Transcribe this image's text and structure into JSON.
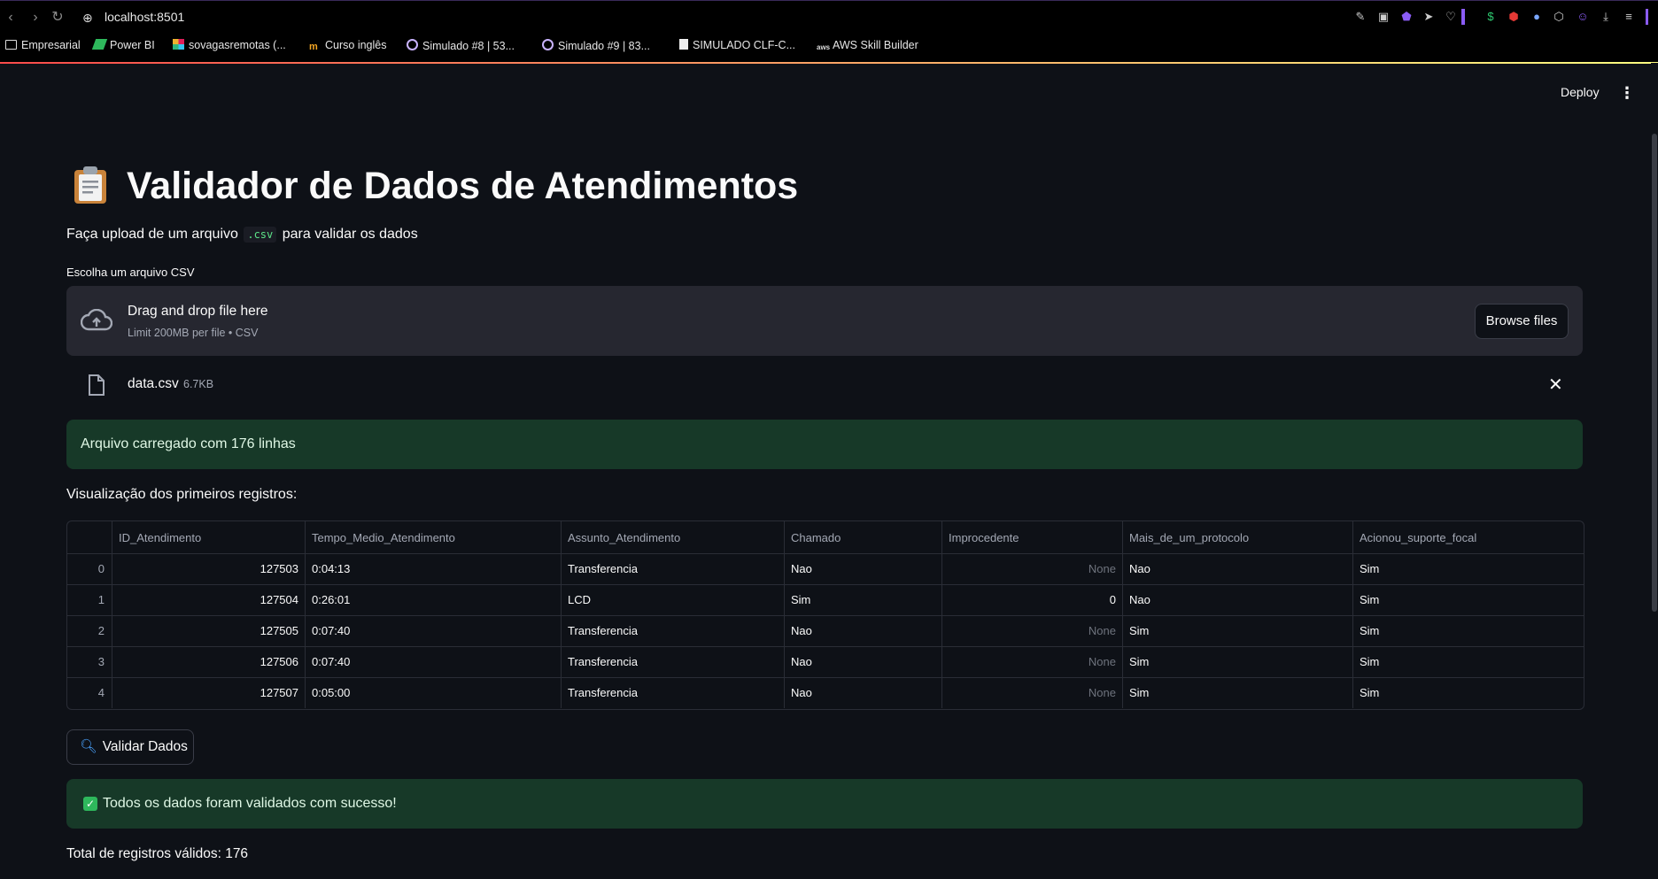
{
  "browser": {
    "url": "localhost:8501",
    "bookmarks": [
      {
        "label": "Empresarial",
        "icon": "folder-icon"
      },
      {
        "label": "Power BI",
        "icon": "powerbi-icon"
      },
      {
        "label": "sovagasremotas (...",
        "icon": "slack-icon"
      },
      {
        "label": "Curso inglês",
        "icon": "course-icon"
      },
      {
        "label": "Simulado #8 | 53...",
        "icon": "quiz-icon"
      },
      {
        "label": "Simulado #9 | 83...",
        "icon": "quiz-icon"
      },
      {
        "label": "SIMULADO CLF-C...",
        "icon": "document-icon"
      },
      {
        "label": "AWS Skill Builder",
        "icon": "aws-icon"
      }
    ]
  },
  "header": {
    "deploy_label": "Deploy",
    "menu_glyph": "⋮"
  },
  "page": {
    "title_emoji": "clipboard-icon",
    "title": "Validador de Dados de Atendimentos",
    "subtitle_before": "Faça upload de um arquivo",
    "subtitle_code": ".csv",
    "subtitle_after": "para validar os dados"
  },
  "uploader": {
    "label": "Escolha um arquivo CSV",
    "drop_title": "Drag and drop file here",
    "drop_sub": "Limit 200MB per file • CSV",
    "browse_label": "Browse files",
    "file_name": "data.csv",
    "file_size": "6.7KB"
  },
  "status": {
    "loaded_msg": "Arquivo carregado com 176 linhas",
    "preview_label": "Visualização dos primeiros registros:",
    "validate_label": "Validar Dados",
    "success_msg": "Todos os dados foram validados com sucesso!",
    "total_label": "Total de registros válidos: 176"
  },
  "table": {
    "columns": [
      "ID_Atendimento",
      "Tempo_Medio_Atendimento",
      "Assunto_Atendimento",
      "Chamado",
      "Improcedente",
      "Mais_de_um_protocolo",
      "Acionou_suporte_focal"
    ],
    "rows": [
      {
        "idx": "0",
        "id": "127503",
        "tempo": "0:04:13",
        "assunto": "Transferencia",
        "chamado": "Nao",
        "improcedente": "None",
        "mais": "Nao",
        "acionou": "Sim"
      },
      {
        "idx": "1",
        "id": "127504",
        "tempo": "0:26:01",
        "assunto": "LCD",
        "chamado": "Sim",
        "improcedente": "0",
        "mais": "Nao",
        "acionou": "Sim"
      },
      {
        "idx": "2",
        "id": "127505",
        "tempo": "0:07:40",
        "assunto": "Transferencia",
        "chamado": "Nao",
        "improcedente": "None",
        "mais": "Sim",
        "acionou": "Sim"
      },
      {
        "idx": "3",
        "id": "127506",
        "tempo": "0:07:40",
        "assunto": "Transferencia",
        "chamado": "Nao",
        "improcedente": "None",
        "mais": "Sim",
        "acionou": "Sim"
      },
      {
        "idx": "4",
        "id": "127507",
        "tempo": "0:05:00",
        "assunto": "Transferencia",
        "chamado": "Nao",
        "improcedente": "None",
        "mais": "Sim",
        "acionou": "Sim"
      }
    ]
  },
  "colors": {
    "background": "#0e1117",
    "dropzone": "#262730",
    "success_bg": "#173928",
    "success_check": "#2eb85c",
    "code_text": "#5ce488"
  }
}
